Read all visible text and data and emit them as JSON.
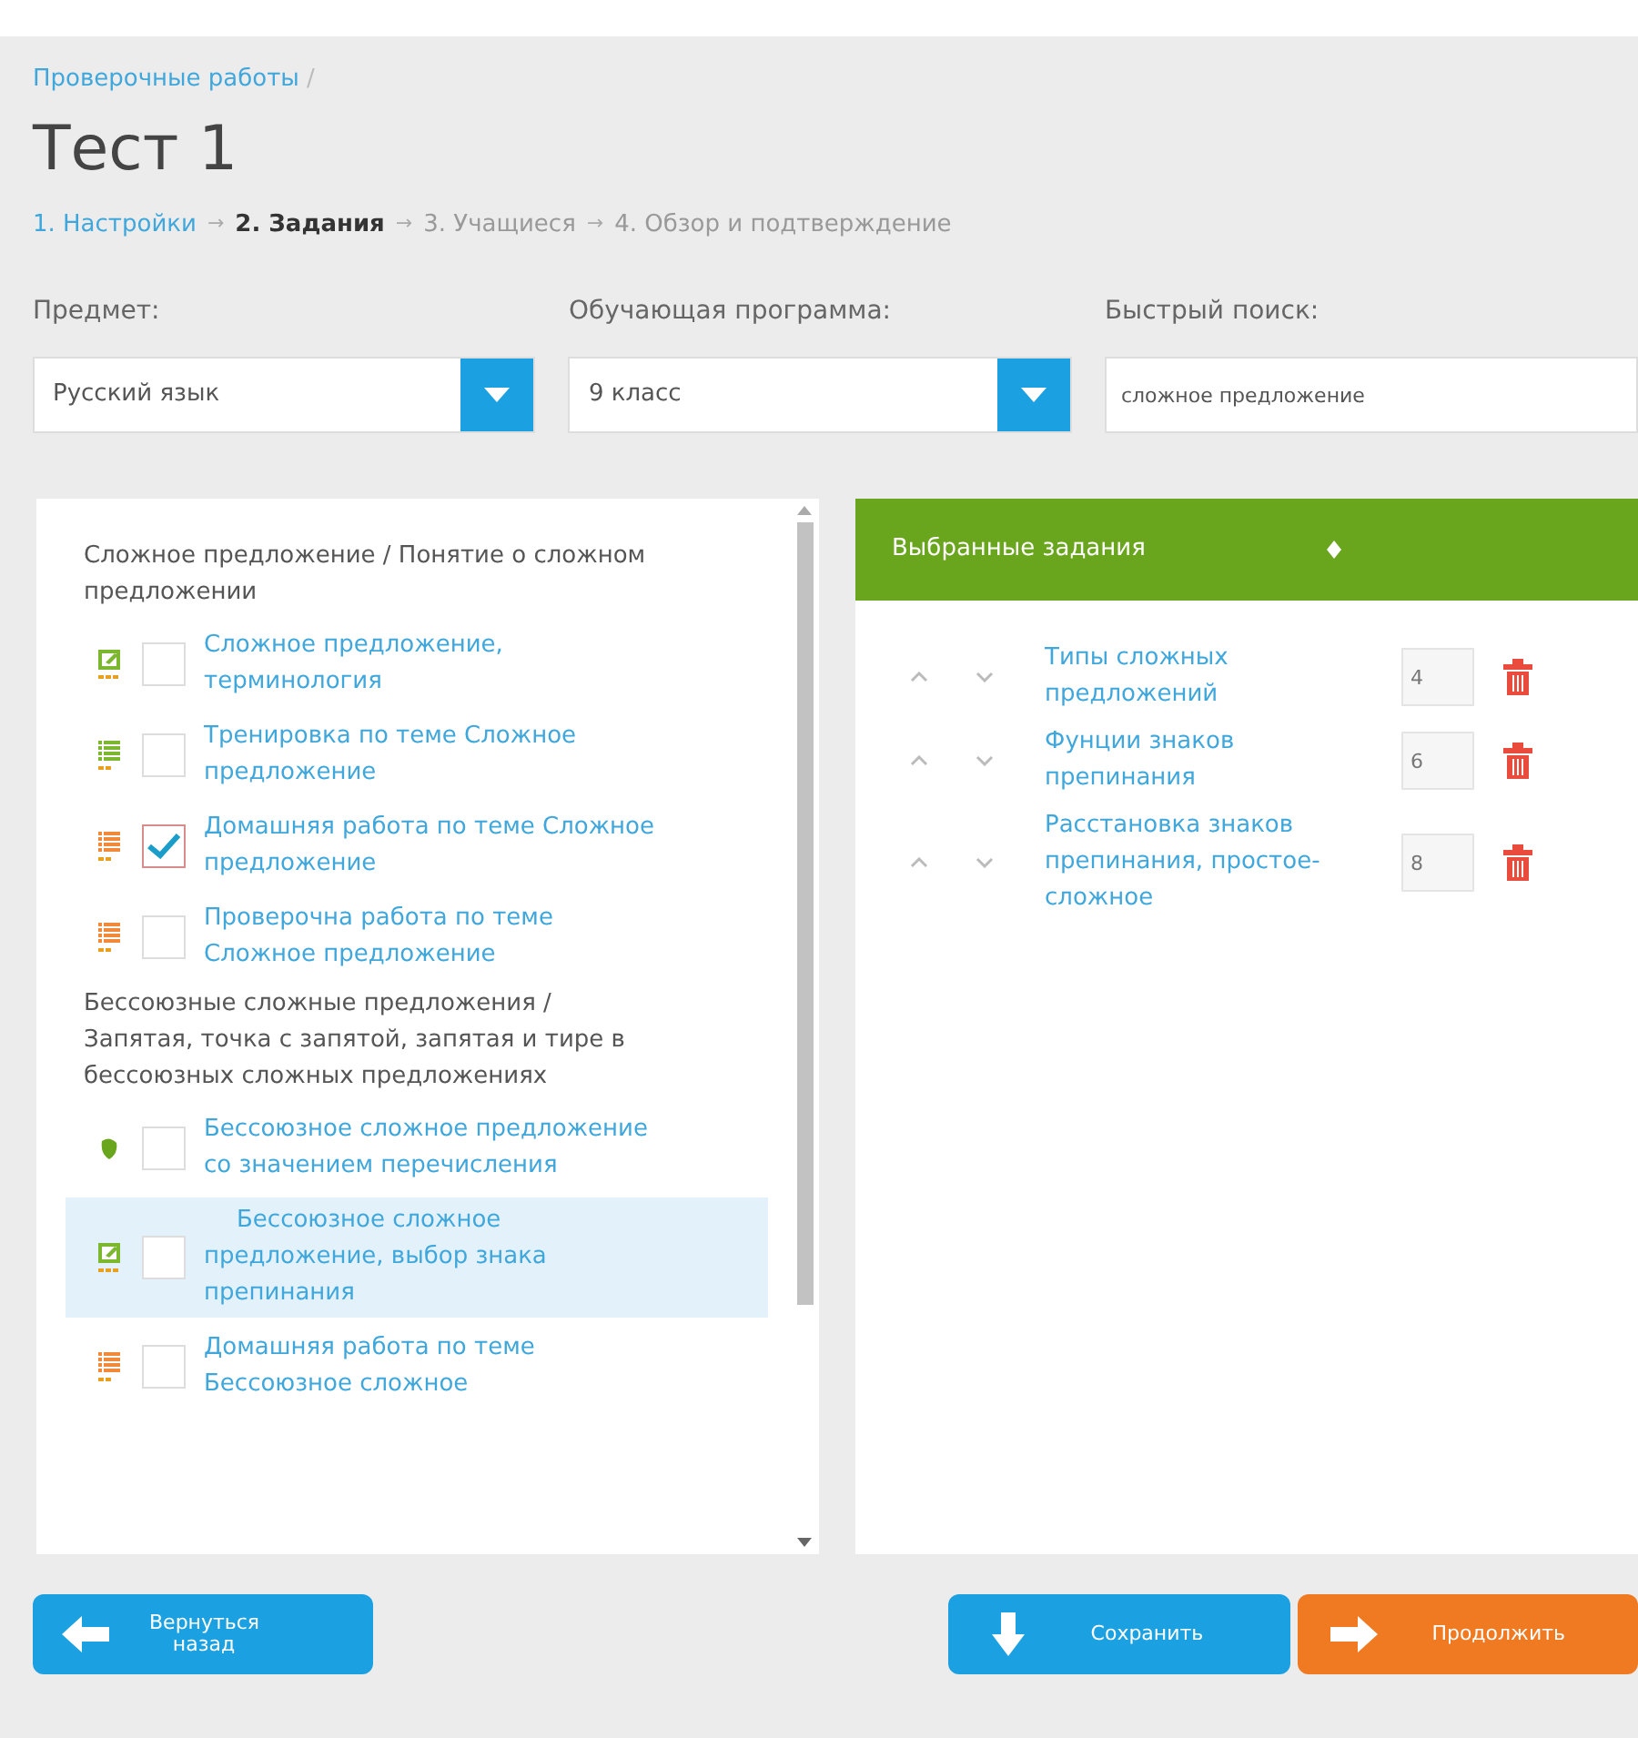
{
  "breadcrumb": {
    "link": "Проверочные работы",
    "separator": "/"
  },
  "title": "Тест 1",
  "steps": [
    {
      "label": "1. Настройки",
      "completed": true,
      "selected": false
    },
    {
      "label": "2. Задания",
      "completed": false,
      "selected": true
    },
    {
      "label": "3. Учащиеся",
      "completed": false,
      "selected": false
    },
    {
      "label": "4. Обзор и подтверждение",
      "completed": false,
      "selected": false
    }
  ],
  "step_separator": "→",
  "filters": [
    {
      "kind": "select",
      "label": "Предмет:",
      "value": "Русский язык"
    },
    {
      "kind": "select",
      "label": "Обучающая программа:",
      "value": "9 класс"
    },
    {
      "kind": "search",
      "label": "Быстрый поиск:",
      "value": "сложное предложение"
    }
  ],
  "tasks": [
    {
      "kind": "group",
      "title": "Сложное предложение / Понятие о сложном предложении"
    },
    {
      "kind": "exercise",
      "title": "Сложное предложение, терминология",
      "checked": false,
      "selected": false
    },
    {
      "kind": "training",
      "title": "Тренировка по теме Сложное предложение",
      "checked": false,
      "selected": false
    },
    {
      "kind": "homework",
      "title": "Домашняя работа по теме Сложное предложение",
      "checked": true,
      "selected": false
    },
    {
      "kind": "homework",
      "title": "Проверочна работа по теме Сложное предложение",
      "checked": false,
      "selected": false
    },
    {
      "kind": "group",
      "title": "Бессоюзные сложные предложения / Запятая, точка с запятой, запятая и тире в бессоюзных сложных предложениях"
    },
    {
      "kind": "lesson",
      "title": "Бессоюзное сложное предложение со значением перечисления",
      "checked": false,
      "selected": false
    },
    {
      "kind": "exercise",
      "title": "Бессоюзное сложное предложение, выбор знака препинания",
      "checked": false,
      "selected": true
    },
    {
      "kind": "homework",
      "title": "Домашняя работа по теме Бессоюзное сложное",
      "checked": false,
      "selected": false
    }
  ],
  "selected_panel": {
    "title": "Выбранные задания",
    "items": [
      {
        "title": "Типы сложных предложений",
        "count": "4"
      },
      {
        "title": "Фунции знаков препинания",
        "count": "6"
      },
      {
        "title": "Расстановка знаков препинания, простое-сложное",
        "count": "8"
      }
    ]
  },
  "buttons": [
    {
      "kind": "back",
      "label": "Вернуться назад"
    },
    {
      "kind": "save",
      "label": "Сохранить"
    },
    {
      "kind": "continue",
      "label": "Продолжить"
    }
  ]
}
